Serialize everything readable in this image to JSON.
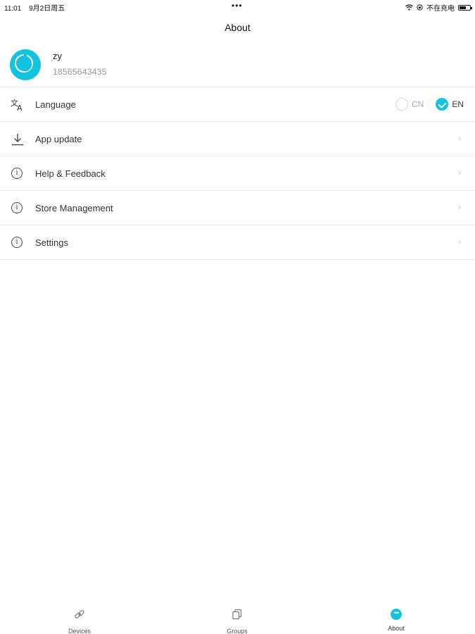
{
  "status": {
    "time": "11:01",
    "date": "9月2日周五",
    "dots": "•••",
    "charging": "不在充电"
  },
  "nav": {
    "title": "About"
  },
  "profile": {
    "name": "zy",
    "phone": "18565643435"
  },
  "menu": {
    "language": {
      "label": "Language",
      "options": [
        {
          "label": "CN",
          "selected": false
        },
        {
          "label": "EN",
          "selected": true
        }
      ]
    },
    "items": [
      {
        "label": "App update",
        "icon": "download-icon"
      },
      {
        "label": "Help & Feedback",
        "icon": "info-icon"
      },
      {
        "label": "Store Management",
        "icon": "info-icon"
      },
      {
        "label": "Settings",
        "icon": "info-icon"
      }
    ]
  },
  "tabs": [
    {
      "label": "Devices",
      "icon": "link-icon",
      "active": false
    },
    {
      "label": "Groups",
      "icon": "copy-icon",
      "active": false
    },
    {
      "label": "About",
      "icon": "more-icon",
      "active": true
    }
  ],
  "colors": {
    "accent": "#12c3e0"
  }
}
